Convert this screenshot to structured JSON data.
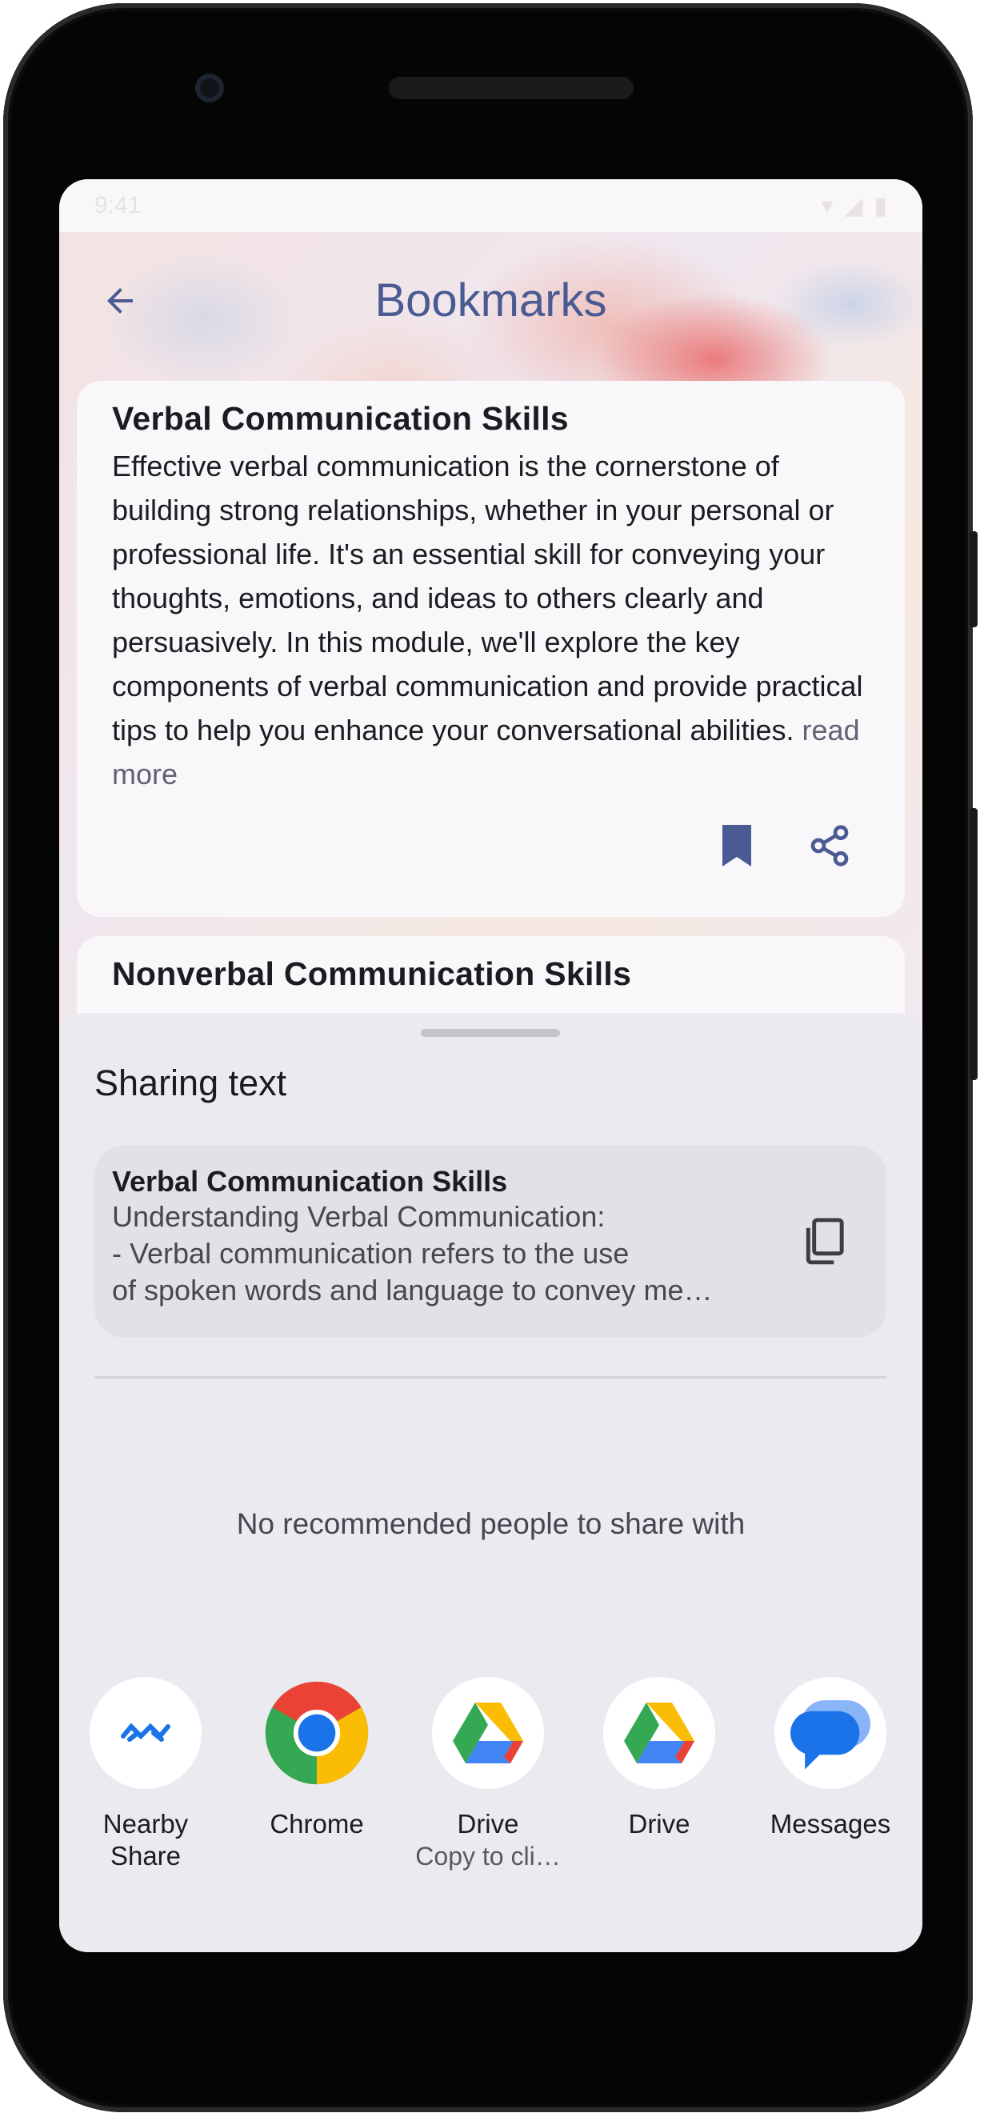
{
  "app": {
    "title": "Bookmarks"
  },
  "cards": [
    {
      "title": "Verbal Communication Skills",
      "body": "Effective verbal communication is the cornerstone of building strong relationships, whether in your personal or professional life. It's an essential skill for conveying your thoughts, emotions, and ideas to others clearly and persuasively. In this module, we'll explore the key components of verbal communication and provide practical tips to help you enhance your conversational abilities.",
      "read_more": "read more"
    },
    {
      "title": "Nonverbal Communication Skills"
    }
  ],
  "share_sheet": {
    "title": "Sharing text",
    "preview": {
      "title": "Verbal Communication Skills",
      "line1": "Understanding Verbal Communication:",
      "line2": "- Verbal communication refers to the use",
      "line3": "of spoken words and language to convey me…"
    },
    "no_people": "No recommended people to share with",
    "targets": [
      {
        "label": "Nearby Share",
        "sub": "",
        "icon": "nearby-share-icon"
      },
      {
        "label": "Chrome",
        "sub": "",
        "icon": "chrome-icon"
      },
      {
        "label": "Drive",
        "sub": "Copy to cli…",
        "icon": "drive-icon"
      },
      {
        "label": "Drive",
        "sub": "",
        "icon": "drive-icon"
      },
      {
        "label": "Messages",
        "sub": "",
        "icon": "messages-icon"
      }
    ]
  },
  "colors": {
    "title": "#4a5a93",
    "bookmark": "#4a5a93",
    "sheet_bg": "#eceaf1"
  }
}
